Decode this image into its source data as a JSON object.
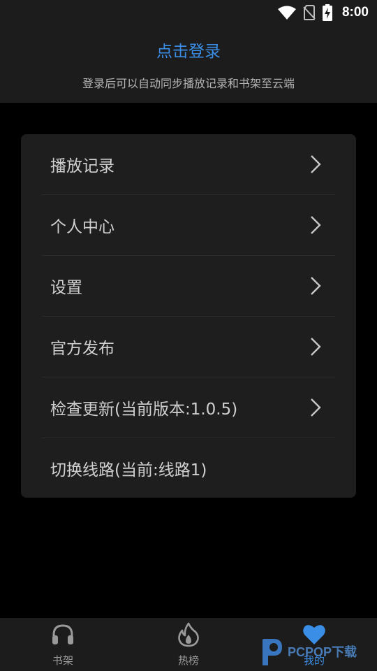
{
  "status_bar": {
    "time": "8:00",
    "icons": [
      "wifi-icon",
      "no-sim-icon",
      "battery-charging-icon"
    ]
  },
  "header": {
    "login_link": "点击登录",
    "login_hint": "登录后可以自动同步播放记录和书架至云端",
    "link_color": "#3a8ee6"
  },
  "menu": {
    "items": [
      {
        "label": "播放记录",
        "has_chevron": true
      },
      {
        "label": "个人中心",
        "has_chevron": true
      },
      {
        "label": "设置",
        "has_chevron": true
      },
      {
        "label": "官方发布",
        "has_chevron": true
      },
      {
        "label": "检查更新(当前版本:1.0.5)",
        "has_chevron": true
      },
      {
        "label": "切换线路(当前:线路1)",
        "has_chevron": false
      }
    ]
  },
  "bottom_nav": {
    "items": [
      {
        "label": "书架",
        "icon": "headphones-icon",
        "active": false
      },
      {
        "label": "热榜",
        "icon": "flame-icon",
        "active": false
      },
      {
        "label": "我的",
        "icon": "heart-icon",
        "active": true
      }
    ],
    "active_color": "#3a8ee6",
    "inactive_color": "#9a9a9a"
  },
  "watermark": {
    "text": "PCPOP下载"
  }
}
